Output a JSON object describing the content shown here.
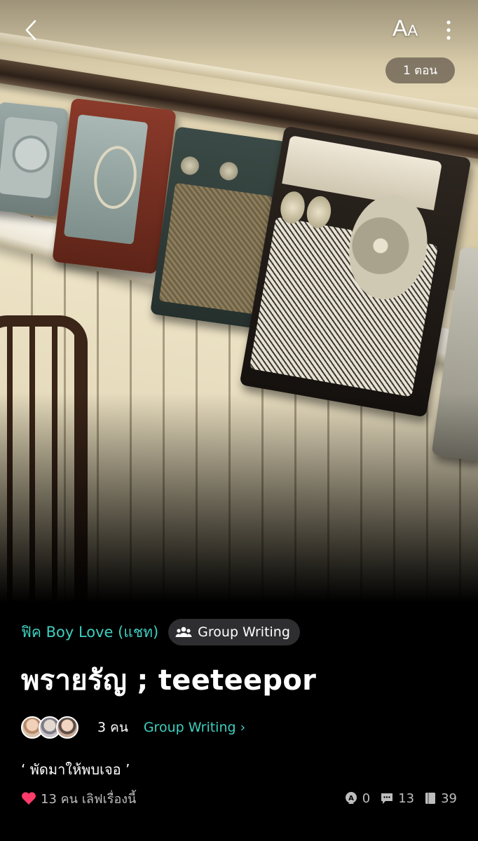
{
  "topbar": {
    "font_size_big": "A",
    "font_size_small": "A",
    "chapter_pill": "1 ตอน"
  },
  "story": {
    "category": "ฟิค Boy Love (แชท)",
    "badge": "Group Writing",
    "title": "พรายรัญ ; teeteepor",
    "member_count": "3 คน",
    "group_link": "Group Writing ›",
    "quote": "‘  พัดมาให้พบเจอ  ’",
    "likes": "13 คน เลิฟเรื่องนี้",
    "stats": {
      "awards": "0",
      "comments": "13",
      "chapters_or_reads": "39"
    }
  },
  "colors": {
    "accent": "#3ecfc0",
    "heart": "#ff3b6b",
    "background": "#000000",
    "badge_bg": "#2e2e30",
    "muted_text": "#bdbdbd"
  },
  "icons": [
    "back-arrow-icon",
    "font-size-icon",
    "more-vertical-icon",
    "group-people-icon",
    "heart-icon",
    "award-icon",
    "comment-icon",
    "book-icon"
  ]
}
